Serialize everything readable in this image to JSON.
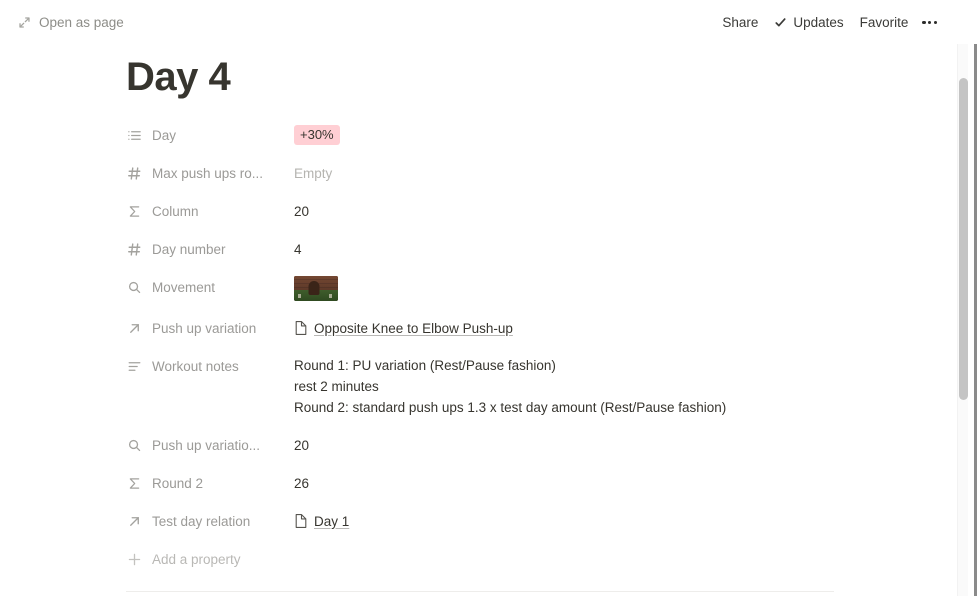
{
  "topbar": {
    "open_as_page": "Open as page",
    "open_icon": "expand-arrows-icon",
    "share": "Share",
    "updates": "Updates",
    "updates_icon": "check-icon",
    "favorite": "Favorite",
    "more_icon": "more-horizontal-icon"
  },
  "page": {
    "title": "Day 4",
    "add_property": "Add a property"
  },
  "properties": [
    {
      "label": "Day",
      "icon": "multi-select-list-icon",
      "value_type": "tag",
      "value": "+30%",
      "tag_color": "#ffcfd4"
    },
    {
      "label": "Max push ups ro...",
      "icon": "number-hash-icon",
      "value_type": "empty",
      "value": "Empty"
    },
    {
      "label": "Column",
      "icon": "formula-sigma-icon",
      "value_type": "text",
      "value": "20"
    },
    {
      "label": "Day number",
      "icon": "number-hash-icon",
      "value_type": "text",
      "value": "4"
    },
    {
      "label": "Movement",
      "icon": "rollup-magnifier-icon",
      "value_type": "image",
      "value": ""
    },
    {
      "label": "Push up variation",
      "icon": "relation-arrow-icon",
      "value_type": "page-link",
      "value": "Opposite Knee to Elbow Push-up"
    },
    {
      "label": "Workout notes",
      "icon": "text-lines-icon",
      "value_type": "multiline",
      "lines": [
        "Round 1: PU variation (Rest/Pause fashion)",
        "rest 2 minutes",
        "Round 2: standard push ups 1.3 x test day amount (Rest/Pause fashion)"
      ]
    },
    {
      "label": "Push up variatio...",
      "icon": "rollup-magnifier-icon",
      "value_type": "text",
      "value": "20"
    },
    {
      "label": "Round 2",
      "icon": "formula-sigma-icon",
      "value_type": "text",
      "value": "26"
    },
    {
      "label": "Test day relation",
      "icon": "relation-arrow-icon",
      "value_type": "page-link",
      "value": "Day 1"
    }
  ]
}
